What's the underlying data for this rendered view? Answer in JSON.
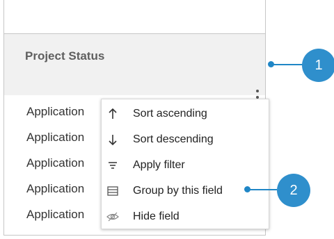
{
  "column": {
    "title": "Project Status",
    "cells": [
      "Application",
      "Application",
      "Application",
      "Application",
      "Application"
    ]
  },
  "menu": {
    "items": [
      {
        "label": "Sort ascending",
        "icon": "arrow-up-icon"
      },
      {
        "label": "Sort descending",
        "icon": "arrow-down-icon"
      },
      {
        "label": "Apply filter",
        "icon": "filter-icon"
      },
      {
        "label": "Group by this field",
        "icon": "group-icon"
      },
      {
        "label": "Hide field",
        "icon": "eye-slash-icon"
      }
    ]
  },
  "callouts": [
    {
      "label": "1"
    },
    {
      "label": "2"
    }
  ],
  "colors": {
    "accent": "#2f8fcc",
    "header_bg": "#f1f1f1"
  }
}
